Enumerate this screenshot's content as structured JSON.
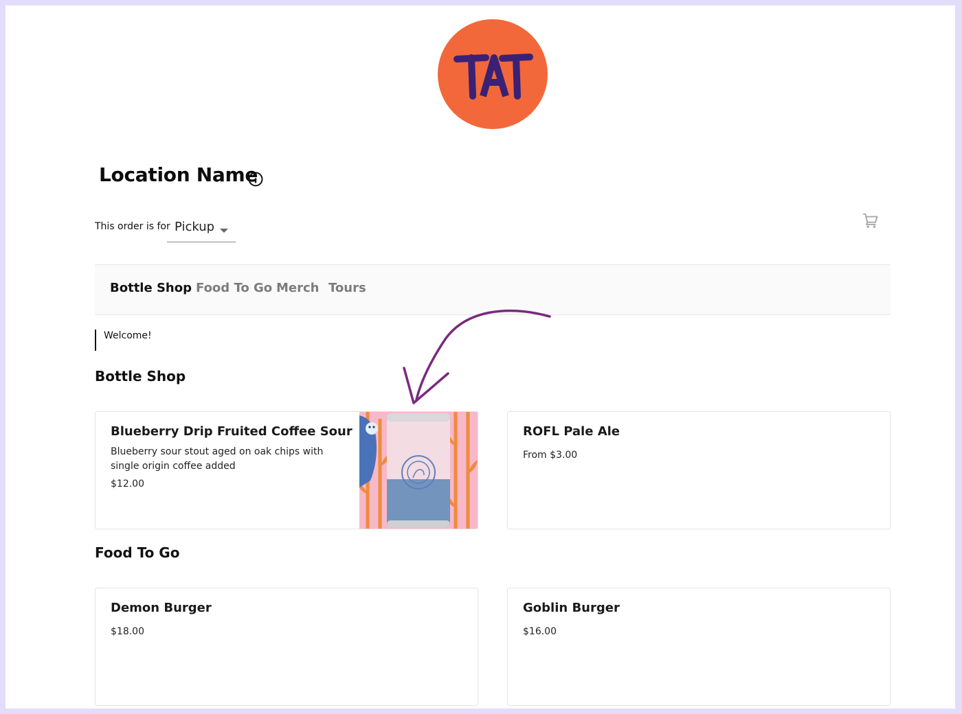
{
  "brand": {
    "logo_text": "TAT",
    "logo_bg": "#f2683a",
    "logo_fg": "#3b2175"
  },
  "location": {
    "title": "Location Name"
  },
  "order": {
    "label": "This order is for",
    "value": "Pickup"
  },
  "icons": [
    "info-icon",
    "cart-icon",
    "dropdown-caret-icon",
    "annotation-arrow"
  ],
  "tabs": [
    {
      "label": "Bottle Shop",
      "active": true
    },
    {
      "label": "Food To Go",
      "active": false
    },
    {
      "label": "Merch",
      "active": false
    },
    {
      "label": "Tours",
      "active": false
    }
  ],
  "welcome": "Welcome!",
  "sections": [
    {
      "title": "Bottle Shop",
      "items": [
        {
          "name": "Blueberry Drip Fruited Coffee Sour",
          "description": "Blueberry sour stout aged on oak chips with single origin coffee added",
          "price": "$12.00",
          "has_image": true
        },
        {
          "name": "ROFL Pale Ale",
          "price": "From $3.00"
        }
      ]
    },
    {
      "title": "Food To Go",
      "items": [
        {
          "name": "Demon Burger",
          "price": "$18.00"
        },
        {
          "name": "Goblin Burger",
          "price": "$16.00"
        }
      ]
    }
  ],
  "colors": {
    "page_border": "#e3ddfb",
    "arrow": "#7a2a7e",
    "tab_inactive": "#7c7c7c"
  }
}
